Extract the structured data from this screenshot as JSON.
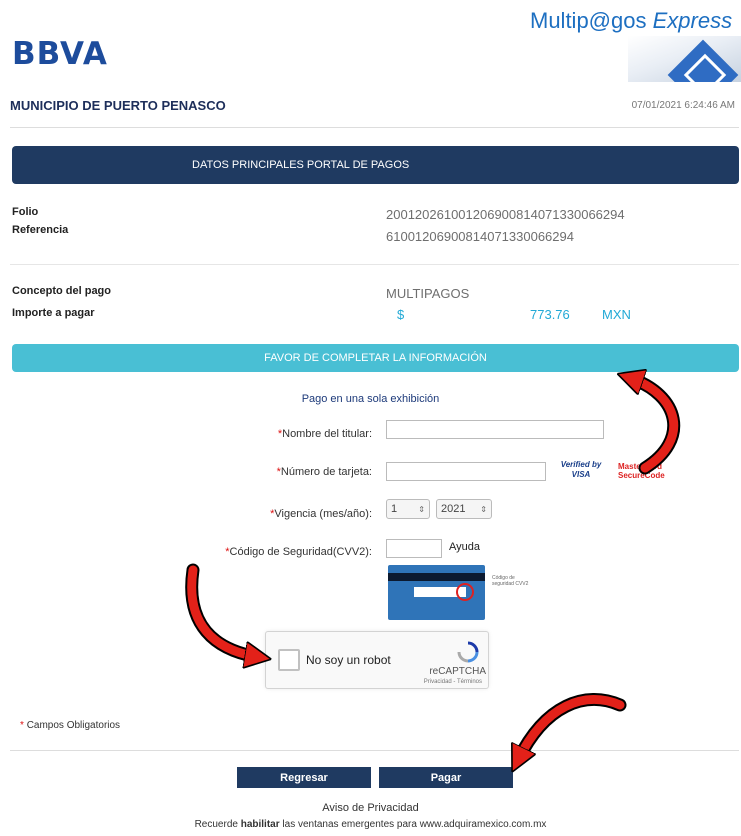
{
  "header": {
    "bank_logo_text": "BBVA",
    "brand_prefix": "Multip@gos",
    "brand_suffix": "Express",
    "municipality": "MUNICIPIO DE PUERTO PENASCO",
    "datetime": "07/01/2021 6:24:46 AM"
  },
  "main_banner": "DATOS PRINCIPALES PORTAL DE PAGOS",
  "info": {
    "folio_label": "Folio",
    "folio_value": "20012026100120690081407133006629​4",
    "referencia_label": "Referencia",
    "referencia_value": "61001206900814071330066294",
    "concepto_label": "Concepto del pago",
    "concepto_value": "MULTIPAGOS",
    "importe_label": "Importe a pagar",
    "currency_symbol": "$",
    "amount": "773.76",
    "currency": "MXN"
  },
  "form_banner": "FAVOR DE COMPLETAR LA INFORMACIÓN",
  "form": {
    "payment_mode": "Pago en una sola exhibición",
    "name_label": "Nombre del titular:",
    "card_label": "Número de tarjeta:",
    "expiry_label": "Vigencia (mes/año):",
    "expiry_month": "1",
    "expiry_year": "2021",
    "cvv_label": "Código de Seguridad(CVV2):",
    "help_link": "Ayuda",
    "verified_visa": "Verified by VISA",
    "mastercard_secure": "MasterCard SecureCode",
    "card_note": "Código de seguridad CVV2",
    "required_marker": "*"
  },
  "recaptcha": {
    "label": "No soy un robot",
    "brand": "reCAPTCHA",
    "terms": "Privacidad - Términos"
  },
  "required_note": "Campos Obligatorios",
  "buttons": {
    "back": "Regresar",
    "pay": "Pagar"
  },
  "footer": {
    "privacy": "Aviso de Privacidad",
    "reminder_prefix": "Recuerde",
    "reminder_bold": "habilitar",
    "reminder_suffix": "las ventanas emergentes para www.adquiramexico.com.mx"
  },
  "colors": {
    "navy": "#1f3a61",
    "cyan_banner": "#49bfd4",
    "amount_cyan": "#22a9d6",
    "arrow_red": "#e32119"
  }
}
